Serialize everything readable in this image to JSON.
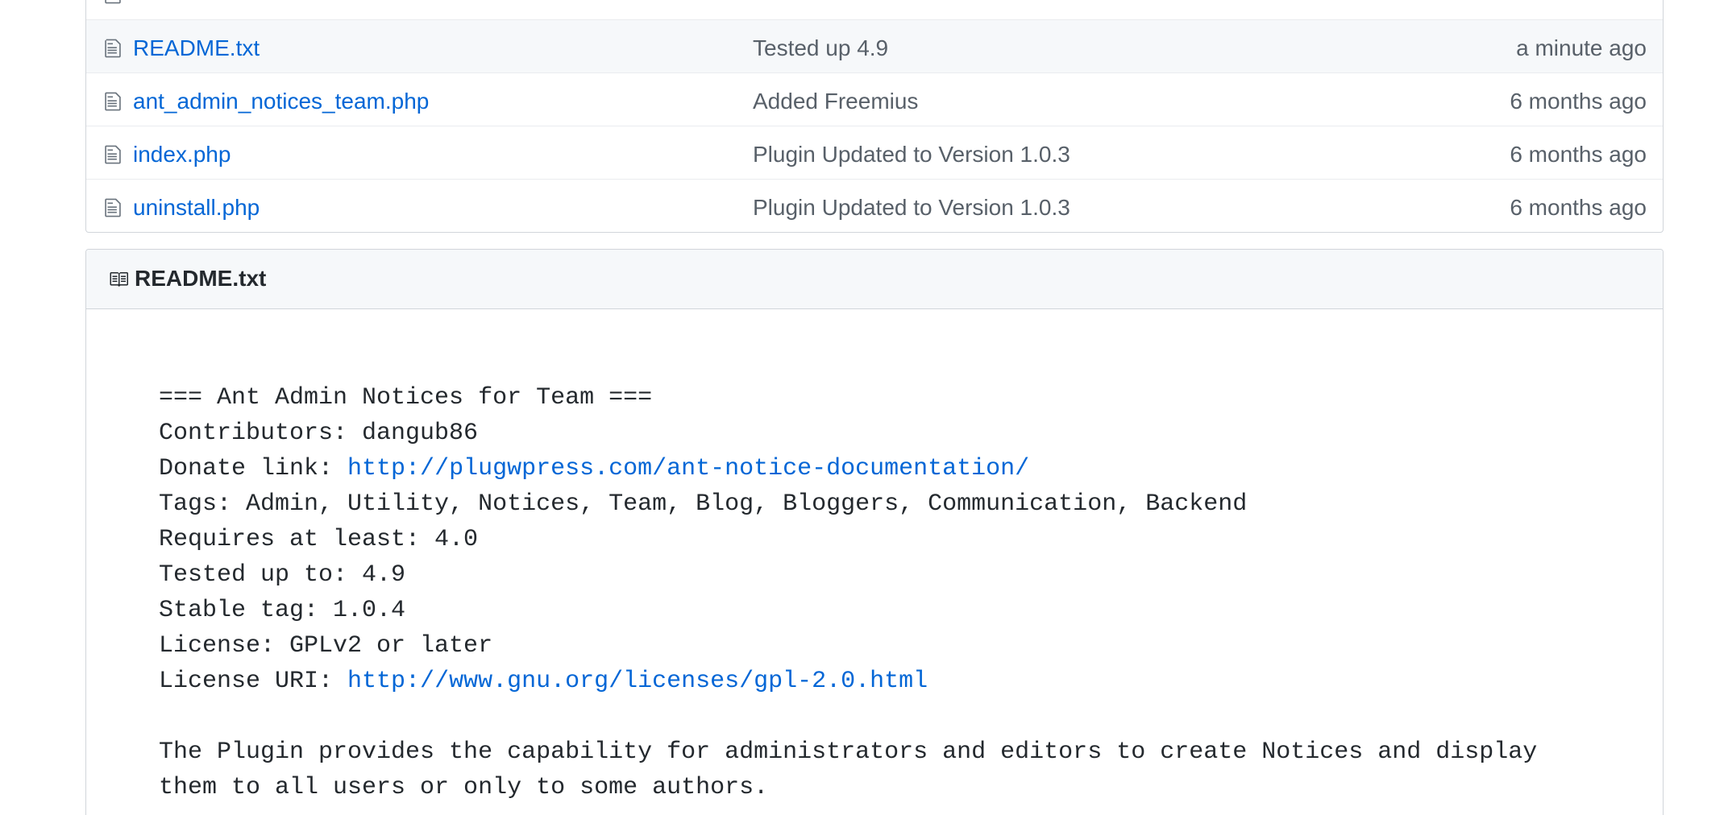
{
  "files": [
    {
      "name": "",
      "message": "",
      "age": ""
    },
    {
      "name": "README.txt",
      "message": "Tested up 4.9",
      "age": "a minute ago"
    },
    {
      "name": "ant_admin_notices_team.php",
      "message": "Added Freemius",
      "age": "6 months ago"
    },
    {
      "name": "index.php",
      "message": "Plugin Updated to Version 1.0.3",
      "age": "6 months ago"
    },
    {
      "name": "uninstall.php",
      "message": "Plugin Updated to Version 1.0.3",
      "age": "6 months ago"
    }
  ],
  "readme": {
    "title": "README.txt",
    "heading": "=== Ant Admin Notices for Team ===",
    "contributors": "Contributors: dangub86",
    "donate_label": "Donate link: ",
    "donate_url": "http://plugwpress.com/ant-notice-documentation/",
    "tags": "Tags: Admin, Utility, Notices, Team, Blog, Bloggers, Communication, Backend",
    "requires": "Requires at least: 4.0",
    "tested": "Tested up to: 4.9",
    "stable": "Stable tag: 1.0.4",
    "license": "License: GPLv2 or later",
    "license_uri_label": "License URI: ",
    "license_uri": "http://www.gnu.org/licenses/gpl-2.0.html",
    "description_line1": "The Plugin provides the capability for administrators and editors to create Notices and display",
    "description_line2": "them to all users or only to some authors."
  },
  "icons": {
    "file": "file-text-icon",
    "readme": "book-icon"
  },
  "colors": {
    "link": "#0366d6",
    "muted": "#586069",
    "border": "#d1d5da",
    "header_bg": "#f6f8fa"
  }
}
